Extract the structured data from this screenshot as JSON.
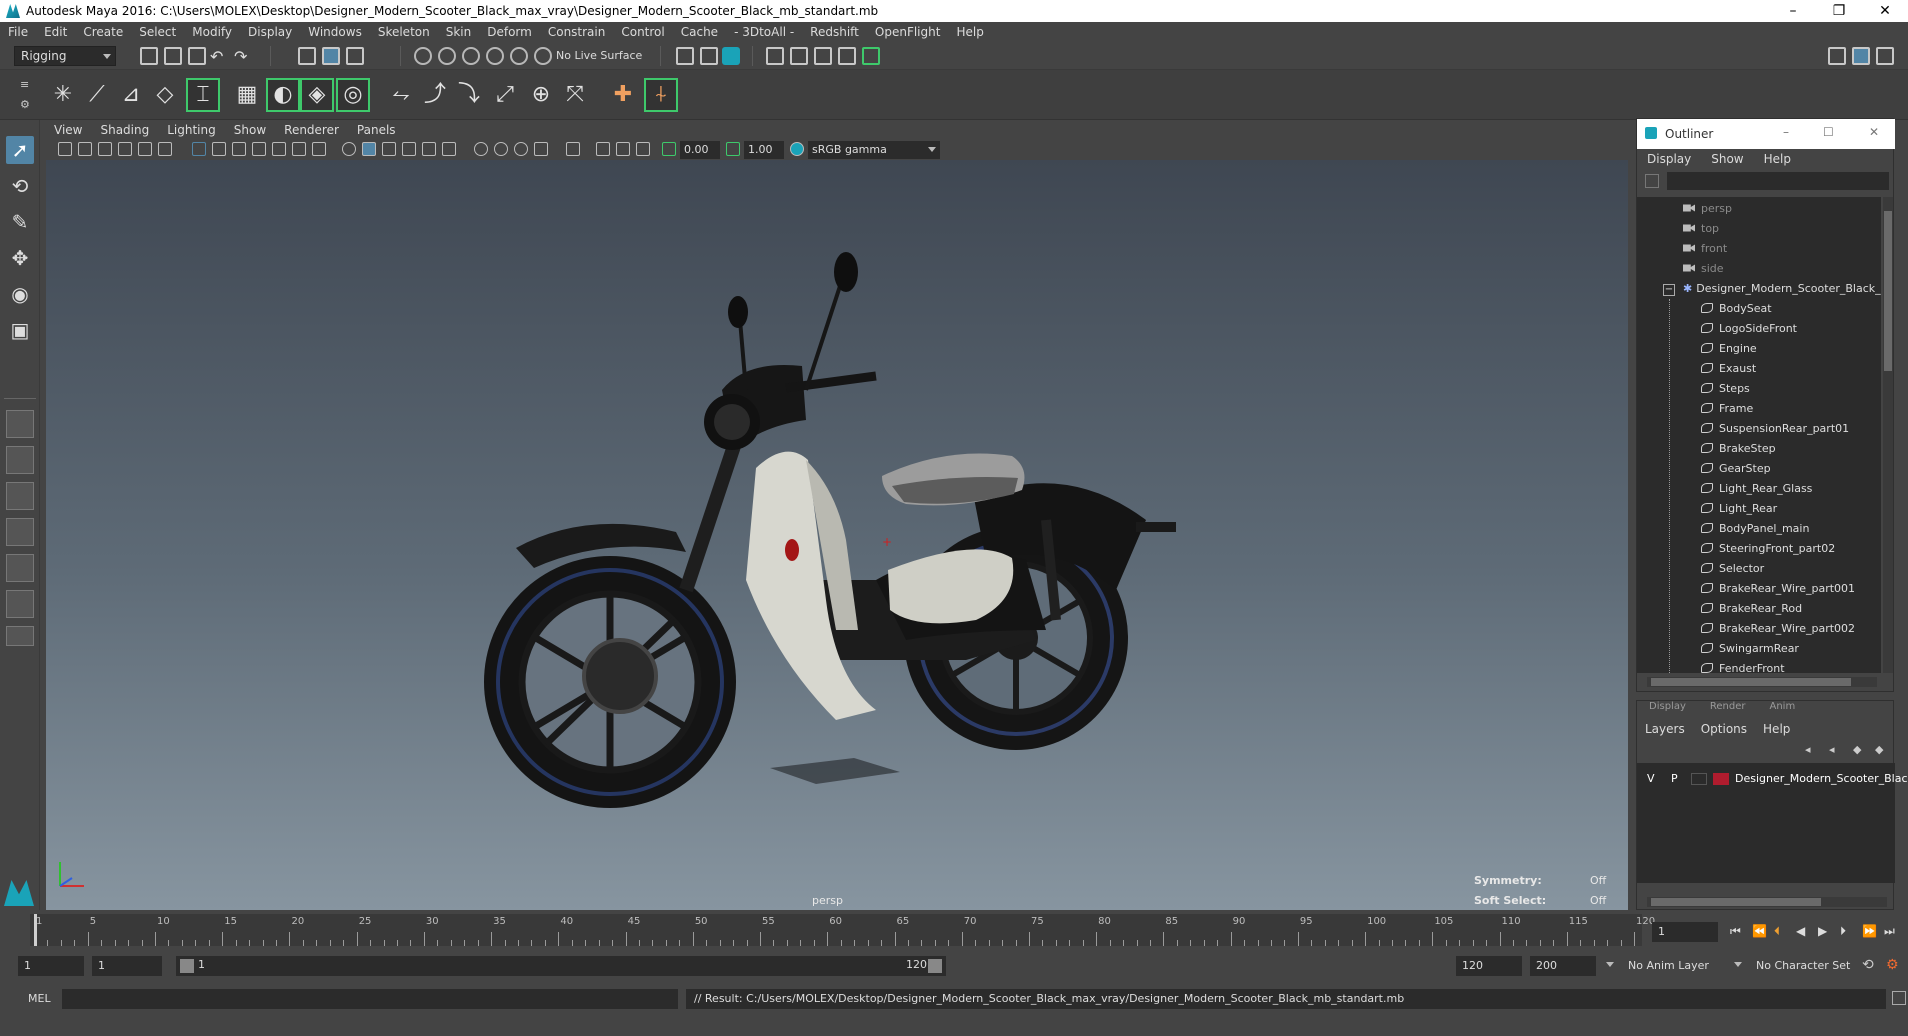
{
  "window": {
    "title": "Autodesk Maya 2016: C:\\Users\\MOLEX\\Desktop\\Designer_Modern_Scooter_Black_max_vray\\Designer_Modern_Scooter_Black_mb_standart.mb",
    "minimize_glyph": "–",
    "restore_glyph": "❐",
    "close_glyph": "✕"
  },
  "menubar": [
    "File",
    "Edit",
    "Create",
    "Select",
    "Modify",
    "Display",
    "Windows",
    "Skeleton",
    "Skin",
    "Deform",
    "Constrain",
    "Control",
    "Cache",
    "- 3DtoAll -",
    "Redshift",
    "OpenFlight",
    "Help"
  ],
  "statusline": {
    "menuset": "Rigging",
    "live_surface": "No Live Surface"
  },
  "viewport": {
    "menu": [
      "View",
      "Shading",
      "Lighting",
      "Show",
      "Renderer",
      "Panels"
    ],
    "exposure": "0.00",
    "gamma": "1.00",
    "color_space": "sRGB gamma",
    "camera_label": "persp",
    "symmetry_label": "Symmetry:",
    "symmetry_value": "Off",
    "soft_select_label": "Soft Select:",
    "soft_select_value": "Off"
  },
  "outliner": {
    "title": "Outliner",
    "menu": [
      "Display",
      "Show",
      "Help"
    ],
    "cameras": [
      "persp",
      "top",
      "front",
      "side"
    ],
    "group": "Designer_Modern_Scooter_Black_n",
    "collapse_glyph": "−",
    "children": [
      "BodySeat",
      "LogoSideFront",
      "Engine",
      "Exaust",
      "Steps",
      "Frame",
      "SuspensionRear_part01",
      "BrakeStep",
      "GearStep",
      "Light_Rear_Glass",
      "Light_Rear",
      "BodyPanel_main",
      "SteeringFront_part02",
      "Selector",
      "BrakeRear_Wire_part001",
      "BrakeRear_Rod",
      "BrakeRear_Wire_part002",
      "SwingarmRear",
      "FenderFront"
    ]
  },
  "layers": {
    "tabs": [
      "Display",
      "Render",
      "Anim"
    ],
    "menu": [
      "Layers",
      "Options",
      "Help"
    ],
    "visible": "V",
    "playback": "P",
    "layer_color": "#b01c2e",
    "layer_name": "Designer_Modern_Scooter_Black"
  },
  "timeslider": {
    "ticks": [
      "1",
      "5",
      "10",
      "15",
      "20",
      "25",
      "30",
      "35",
      "40",
      "45",
      "50",
      "55",
      "60",
      "65",
      "70",
      "75",
      "80",
      "85",
      "90",
      "95",
      "100",
      "105",
      "110",
      "115",
      "120"
    ],
    "current_frame": "1"
  },
  "range": {
    "start": "1",
    "playback_start": "1",
    "slider_start": "1",
    "slider_end": "120",
    "playback_end": "120",
    "end": "200",
    "anim_layer": "No Anim Layer",
    "character_set": "No Character Set"
  },
  "cmdline": {
    "lang": "MEL",
    "result": "// Result: C:/Users/MOLEX/Desktop/Designer_Modern_Scooter_Black_max_vray/Designer_Modern_Scooter_Black_mb_standart.mb"
  },
  "colors": {
    "accent_green": "#3ec96b",
    "select_blue": "#5285a6",
    "accent_teal": "#1aa3b8"
  }
}
